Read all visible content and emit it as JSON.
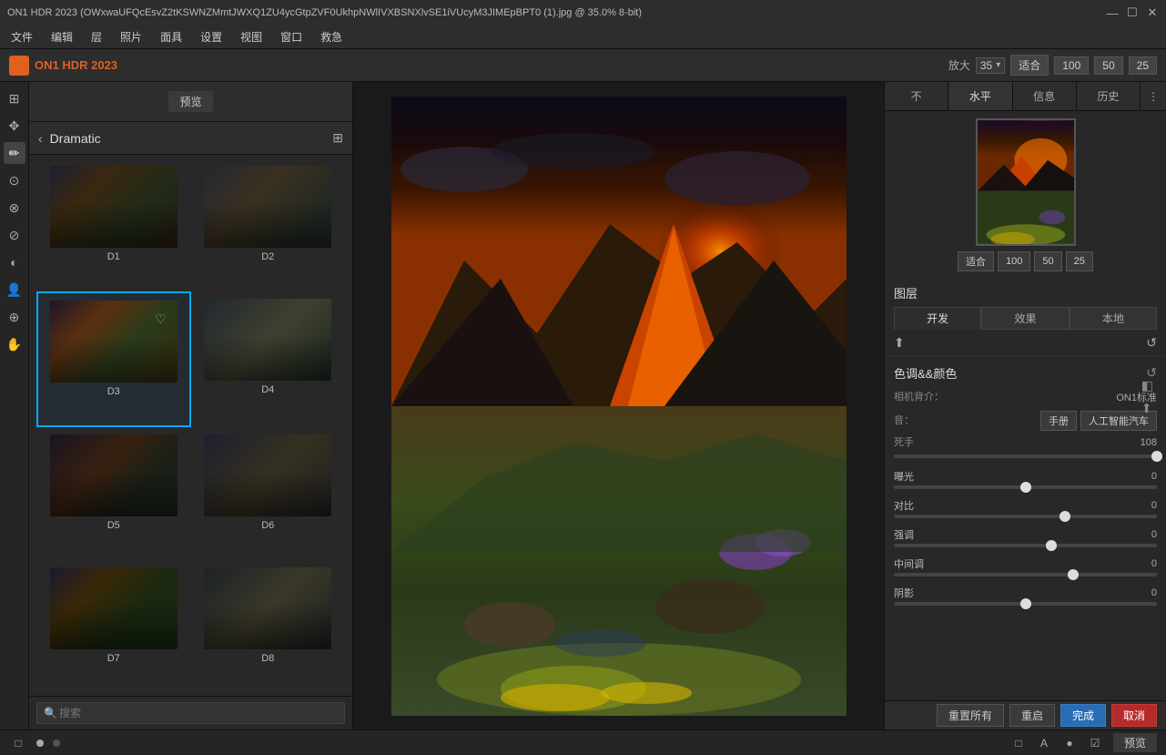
{
  "titlebar": {
    "title": "ON1 HDR 2023 (OWxwaUFQcEsvZ2tKSWNZMmtJWXQ1ZU4ycGtpZVF0UkhpNWlIVXBSNXlvSE1iVUcyM3JIMEpBPT0 (1).jpg @ 35.0% 8-bit)",
    "controls": [
      "—",
      "☐",
      "✕"
    ]
  },
  "menubar": {
    "items": [
      "文件",
      "编辑",
      "层",
      "照片",
      "面具",
      "设置",
      "视图",
      "窗口",
      "救急"
    ]
  },
  "toolbar": {
    "app_name": "ON1 HDR 2023",
    "zoom_label": "放大",
    "zoom_value": "35",
    "zoom_dropdown": "▾",
    "fit_label": "适合",
    "zoom_100": "100",
    "zoom_50": "50",
    "zoom_25": "25"
  },
  "left_panel": {
    "preview_btn": "预览",
    "back_label": "Dramatic",
    "presets": [
      {
        "id": "D1",
        "label": "D1",
        "thumb_class": "thumb-d1"
      },
      {
        "id": "D2",
        "label": "D2",
        "thumb_class": "thumb-d2"
      },
      {
        "id": "D3",
        "label": "D3",
        "thumb_class": "thumb-d3",
        "selected": true
      },
      {
        "id": "D4",
        "label": "D4",
        "thumb_class": "thumb-d4"
      },
      {
        "id": "D5",
        "label": "D5",
        "thumb_class": "thumb-d5"
      },
      {
        "id": "D6",
        "label": "D6",
        "thumb_class": "thumb-d6"
      },
      {
        "id": "D7",
        "label": "D7",
        "thumb_class": "thumb-d7"
      },
      {
        "id": "D8",
        "label": "D8",
        "thumb_class": "thumb-d8"
      }
    ],
    "search_placeholder": "搜索"
  },
  "right_panel": {
    "tabs": [
      "不",
      "水平",
      "信息",
      "历史"
    ],
    "preview_zoom": {
      "fit": "适合",
      "z100": "100",
      "z50": "50",
      "z25": "25"
    },
    "layers": {
      "title": "图层",
      "tabs": [
        "开发",
        "效果",
        "本地"
      ]
    },
    "tone_color": {
      "title": "色调&&颜色",
      "camera_label": "相机背介：",
      "camera_value": "ON1标准",
      "tone_label": "音：",
      "manual_btn": "手册",
      "auto_btn": "人工智能汽车",
      "opacity_label": "死手",
      "opacity_value": "108",
      "sliders": [
        {
          "label": "曝光",
          "value": 0,
          "position": 50
        },
        {
          "label": "对比",
          "value": 0,
          "position": 65
        },
        {
          "label": "强调",
          "value": 0,
          "position": 60
        },
        {
          "label": "中间调",
          "value": 0,
          "position": 68
        },
        {
          "label": "阴影",
          "value": 0,
          "position": 50
        }
      ]
    },
    "action_buttons": {
      "reset_all": "重置所有",
      "reset": "重启",
      "done": "完成",
      "cancel": "取消"
    }
  },
  "bottom_bar": {
    "preview_label": "预览"
  }
}
